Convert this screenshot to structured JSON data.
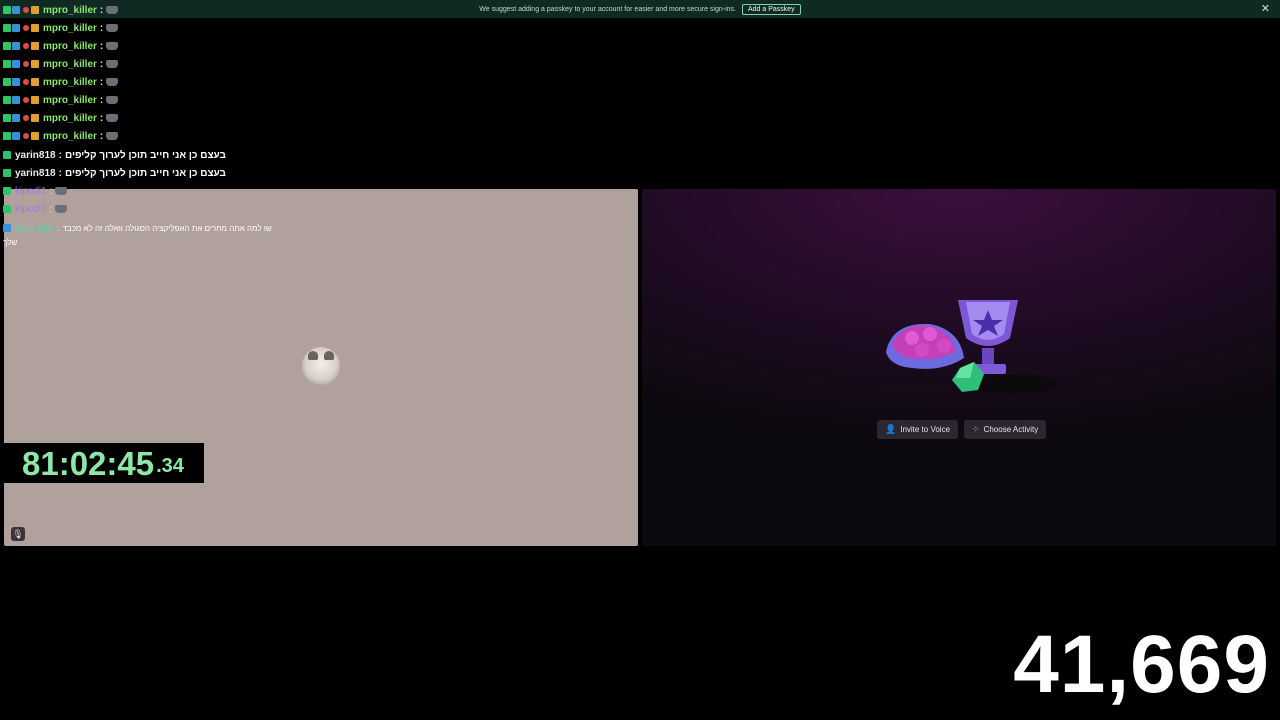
{
  "banner": {
    "text": "We suggest adding a passkey to your account for easier and more secure sign-ins.",
    "button_label": "Add a Passkey",
    "close_label": "✕"
  },
  "chat": {
    "messages": [
      {
        "user": "mpro_killer",
        "sep": ":",
        "text": ""
      },
      {
        "user": "mpro_killer",
        "sep": ":",
        "text": ""
      },
      {
        "user": "mpro_killer",
        "sep": ":",
        "text": ""
      },
      {
        "user": "mpro_killer",
        "sep": ":",
        "text": ""
      },
      {
        "user": "mpro_killer",
        "sep": ":",
        "text": ""
      },
      {
        "user": "mpro_killer",
        "sep": ":",
        "text": ""
      },
      {
        "user": "mpro_killer",
        "sep": ":",
        "text": ""
      },
      {
        "user": "mpro_killer",
        "sep": ":",
        "text": ""
      },
      {
        "user": "yarin818",
        "sep": ":",
        "text": "בעצם כן אני חייב תוכן לערוך קליפים"
      },
      {
        "user": "yarin818",
        "sep": ":",
        "text": "בעצם כן אני חייב תוכן לערוך קליפים"
      },
      {
        "user": "kipodi1",
        "sep": ":",
        "text": ""
      },
      {
        "user": "kipodi1",
        "sep": ":",
        "text": ""
      },
      {
        "user": "mpro_killer",
        "sep": ":",
        "text": "שו למה אתה מחרים את האפליקציה הסגולה וואלה זה לא מכבד"
      }
    ],
    "continuation": "שלך"
  },
  "timer": {
    "main": "81:02:45",
    "fraction": ".34"
  },
  "activity": {
    "invite_label": "Invite to Voice",
    "choose_label": "Choose Activity"
  },
  "counter": "41,669",
  "colors": {
    "banner_bg": "#0f2a22",
    "left_panel": "#b1a19d",
    "timer_text": "#8de7a8",
    "username_green": "#8ce86a"
  }
}
